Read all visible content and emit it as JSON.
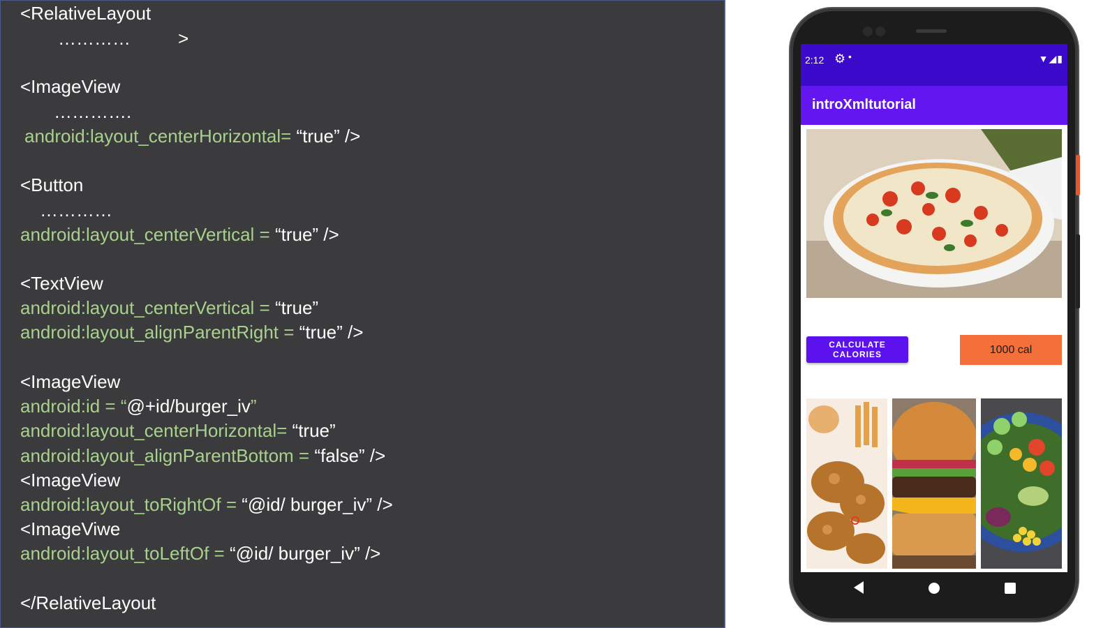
{
  "code": {
    "lines": [
      {
        "tag": "<RelativeLayout"
      },
      {
        "dots": "…………",
        "close": ">"
      },
      {
        "tag": "<ImageView"
      },
      {
        "dots": "…………."
      },
      {
        "attr": "android:layout_centerHorizontal=",
        "val": " “true” />"
      },
      {
        "tag": "<Button"
      },
      {
        "dots": "…………"
      },
      {
        "attr": "android:layout_centerVertical = ",
        "val": "“true” />"
      },
      {
        "tag": "<TextView"
      },
      {
        "attr": "android:layout_centerVertical = ",
        "val": "“true”"
      },
      {
        "attr": "android:layout_alignParentRight = ",
        "val": "“true” />"
      },
      {
        "tag": "<ImageView"
      },
      {
        "attr": "android:id = “",
        "val": "@+id/burger_iv",
        "attr2": "”"
      },
      {
        "attr": "android:layout_centerHorizontal= ",
        "val": "“true”"
      },
      {
        "attr": "android:layout_alignParentBottom = ",
        "val": "“false” />"
      },
      {
        "tag": "<ImageView"
      },
      {
        "attr": "android:layout_toRightOf = ",
        "val": "“@id/ burger_iv” />"
      },
      {
        "tag": "<ImageViwe"
      },
      {
        "attr": "android:layout_toLeftOf = ",
        "val": "“@id/ burger_iv” />"
      },
      {
        "tag": "</RelativeLayout"
      }
    ]
  },
  "phone": {
    "status": {
      "time": "2:12",
      "gear_icon": "gear-icon",
      "dot": "•",
      "icons": "▼◢▮"
    },
    "app_title": "introXmltutorial",
    "calc_button": "CALCULATE CALORIES",
    "calories": "1000 cal",
    "images": [
      "pizza-image",
      "fried-chicken-image",
      "burger-image",
      "salad-image"
    ],
    "colors": {
      "status_bar": "#3b09c9",
      "app_bar": "#6316f0",
      "button": "#5b12ee",
      "calorie_box": "#f3703a"
    }
  }
}
